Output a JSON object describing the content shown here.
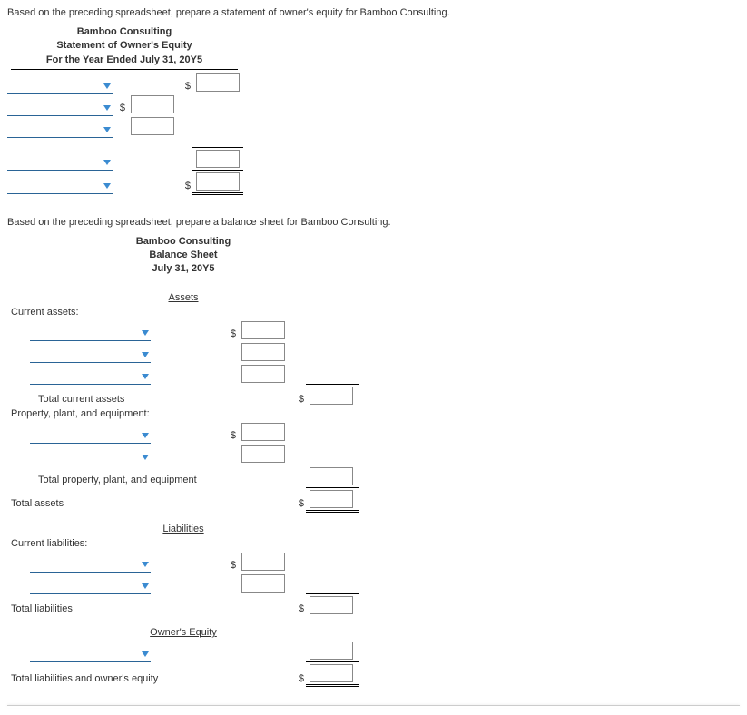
{
  "equity": {
    "instruction": "Based on the preceding spreadsheet, prepare a statement of owner's equity for Bamboo Consulting.",
    "header": {
      "company": "Bamboo Consulting",
      "title": "Statement of Owner's Equity",
      "period": "For the Year Ended July 31, 20Y5"
    },
    "dollar": "$"
  },
  "balance": {
    "instruction": "Based on the preceding spreadsheet, prepare a balance sheet for Bamboo Consulting.",
    "header": {
      "company": "Bamboo Consulting",
      "title": "Balance Sheet",
      "period": "July 31, 20Y5"
    },
    "sections": {
      "assets": "Assets",
      "current_assets": "Current assets:",
      "total_current_assets": "Total current assets",
      "ppe": "Property, plant, and equipment:",
      "total_ppe": "Total property, plant, and equipment",
      "total_assets": "Total assets",
      "liabilities": "Liabilities",
      "current_liabilities": "Current liabilities:",
      "total_liabilities": "Total liabilities",
      "owners_equity": "Owner's Equity",
      "total_liab_equity": "Total liabilities and owner's equity"
    },
    "dollar": "$"
  }
}
